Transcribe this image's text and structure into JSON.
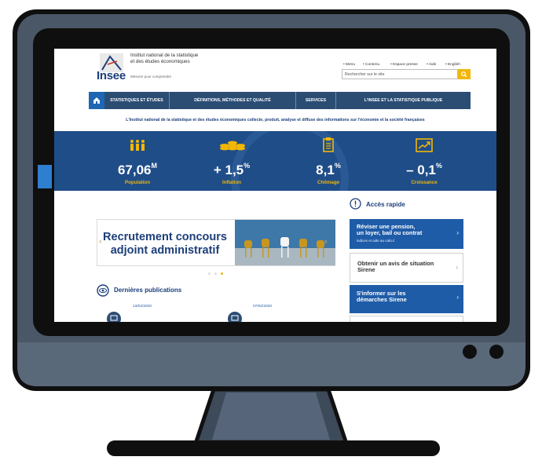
{
  "header": {
    "org_line1": "Institut national de la statistique",
    "org_line2": "et des études économiques",
    "logo_text": "Insee",
    "tagline": "Mesurer pour comprendre",
    "top_links": [
      "• Menu",
      "• Contenu",
      "• Espace presse",
      "• Aide",
      "• English"
    ],
    "search_placeholder": "Rechercher sur le site"
  },
  "nav": {
    "items": [
      "STATISTIQUES ET ÉTUDES",
      "DÉFINITIONS, MÉTHODES ET QUALITÉ",
      "SERVICES",
      "L'INSEE ET LA STATISTIQUE PUBLIQUE"
    ]
  },
  "intro": "L'Institut national de la statistique et des études économiques collecte, produit, analyse et diffuse des informations sur l'économie et la société françaises",
  "stats": [
    {
      "value": "67,06",
      "sup": "M",
      "label": "Population",
      "icon": "people-icon"
    },
    {
      "value": "+ 1,5",
      "sup": "%",
      "label": "Inflation",
      "icon": "coins-icon"
    },
    {
      "value": "8,1",
      "sup": "%",
      "label": "Chômage",
      "icon": "clipboard-icon"
    },
    {
      "value": "– 0,1",
      "sup": "%",
      "label": "Croissance",
      "icon": "growth-chart-icon"
    }
  ],
  "slider": {
    "line1": "Recrutement concours",
    "line2": "adjoint administratif",
    "active_slide": 3,
    "slide_count": 3
  },
  "quick_access": {
    "title": "Accès rapide",
    "cards": [
      {
        "line1": "Réviser une pension,",
        "line2": "un loyer, bail ou contrat",
        "sub": "indices et aide au calcul"
      },
      {
        "line1": "Obtenir un avis de situation",
        "line2": "Sirene",
        "sub": ""
      },
      {
        "line1": "S'informer sur les",
        "line2": "démarches Sirene",
        "sub": ""
      }
    ]
  },
  "publications": {
    "title": "Dernières publications",
    "dates": [
      "13/02/2020",
      "07/02/2020"
    ]
  },
  "colors": {
    "brand_blue": "#1f4d88",
    "nav_blue": "#2b4d74",
    "accent_yellow": "#f2b705",
    "card_blue": "#1f5ca8",
    "monitor_frame": "#4a5766"
  }
}
